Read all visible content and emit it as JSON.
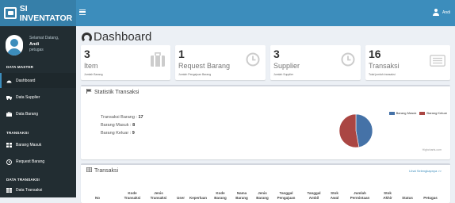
{
  "app": {
    "title": "SI INVENTATOR"
  },
  "user": {
    "greeting": "Selamat Datang,",
    "name": "Andi",
    "role": "petugas",
    "top_name": "Andi"
  },
  "sidebar": {
    "sections": [
      {
        "header": "DATA MASTER",
        "items": [
          {
            "label": "Dashboard",
            "icon": "dashboard-icon",
            "active": true
          },
          {
            "label": "Data Supplier",
            "icon": "truck-icon"
          },
          {
            "label": "Data Barang",
            "icon": "briefcase-icon"
          }
        ]
      },
      {
        "header": "TRANSAKSI",
        "items": [
          {
            "label": "Barang Masuk",
            "icon": "grid-icon"
          },
          {
            "label": "Request Barang",
            "icon": "clock-icon"
          }
        ]
      },
      {
        "header": "DATA TRANSAKSI",
        "items": [
          {
            "label": "Data Transaksi",
            "icon": "table-icon"
          }
        ]
      }
    ]
  },
  "page": {
    "title": "Dashboard"
  },
  "cards": [
    {
      "num": "3",
      "label": "Item",
      "sub": "Jumlah Barang",
      "icon": "briefcase-icon"
    },
    {
      "num": "1",
      "label": "Request Barang",
      "sub": "Jumlah Pengajuan Barang",
      "icon": "clock-icon"
    },
    {
      "num": "3",
      "label": "Supplier",
      "sub": "Jumlah Supplier",
      "icon": "clock-icon"
    },
    {
      "num": "16",
      "label": "Transaksi",
      "sub": "Total jumlah transaksi",
      "icon": "list-icon"
    }
  ],
  "stats": {
    "title": "Statistik Transaksi",
    "lines": [
      {
        "label": "Transaksi Barang :",
        "value": "17"
      },
      {
        "label": "Barang Masuk :",
        "value": "8"
      },
      {
        "label": "Barang Keluar :",
        "value": "9"
      }
    ],
    "credit": "Highcharts.com"
  },
  "chart_data": {
    "type": "pie",
    "series": [
      {
        "name": "Barang Masuk",
        "value": 8,
        "color": "#4572a7"
      },
      {
        "name": "Barang Keluar",
        "value": 9,
        "color": "#aa4643"
      }
    ],
    "legend": "top-right"
  },
  "transaksi": {
    "title": "Transaksi",
    "link": "Lihat Selengkapnya >>",
    "columns": [
      "No",
      "Kode Transaksi",
      "Jenis Transaksi",
      "User",
      "Keperluan",
      "Kode Barang",
      "Nama Barang",
      "Jenis Barang",
      "Tanggal Pengajuan",
      "Tanggal Ambil",
      "Stok Awal",
      "Jumlah Permintaan",
      "Stok Akhir",
      "Status",
      "Petugas"
    ]
  },
  "colors": {
    "sidebar": "#222d32",
    "header": "#3c8dbc",
    "logo": "#367fa9",
    "content_bg": "#ecf0f5"
  }
}
